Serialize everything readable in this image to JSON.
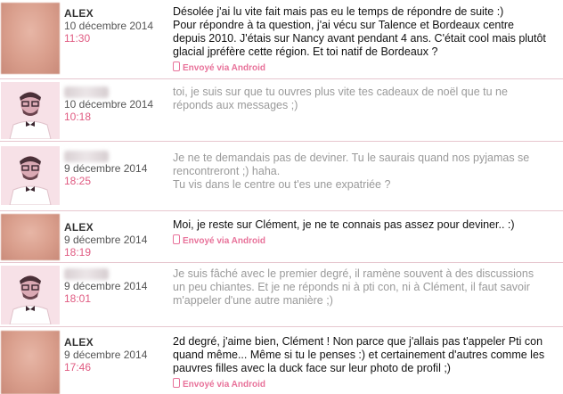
{
  "messages": [
    {
      "author": "ALEX",
      "date": "10 décembre 2014",
      "time": "11:30",
      "avatar": "female-avatar",
      "mine": true,
      "text": "Désolée j'ai lu vite fait mais pas eu le temps de répondre de suite :)\nPour répondre à ta question, j'ai vécu sur Talence et Bordeaux centre depuis 2010. J'étais sur Nancy avant pendant 4 ans. C'était cool mais plutôt glacial jpréfère cette région. Et toi natif de Bordeaux ?",
      "via": "Envoyé via Android"
    },
    {
      "author": "",
      "date": "10 décembre 2014",
      "time": "10:18",
      "avatar": "male-avatar",
      "mine": false,
      "text": "toi, je suis sur que tu ouvres plus vite tes cadeaux de noël que tu ne réponds aux messages ;)"
    },
    {
      "author": "",
      "date": "9 décembre 2014",
      "time": "18:25",
      "avatar": "male-avatar",
      "mine": false,
      "text": "Je ne te demandais pas de deviner. Tu le saurais quand nos pyjamas se rencontreront ;) haha.\nTu vis dans le centre ou t'es une expatriée ?"
    },
    {
      "author": "ALEX",
      "date": "9 décembre 2014",
      "time": "18:19",
      "avatar": "female-avatar",
      "mine": true,
      "text": "Moi, je reste sur Clément, je ne te connais pas assez pour deviner.. :)",
      "via": "Envoyé via Android"
    },
    {
      "author": "",
      "date": "9 décembre 2014",
      "time": "18:01",
      "avatar": "male-avatar",
      "mine": false,
      "text": "Je suis fâché avec le premier degré, il ramène souvent à des discussions un peu chiantes. Et je ne réponds ni à pti con, ni à Clément, il faut savoir m'appeler d'une autre manière ;)"
    },
    {
      "author": "ALEX",
      "date": "9 décembre 2014",
      "time": "17:46",
      "avatar": "female-avatar",
      "mine": true,
      "text": "2d degré, j'aime bien, Clément ! Non parce que j'allais pas t'appeler Pti con quand même... Même si tu le penses :) et certainement d'autres comme les pauvres filles avec la duck face sur leur photo de profil ;)",
      "via": "Envoyé via Android"
    }
  ]
}
